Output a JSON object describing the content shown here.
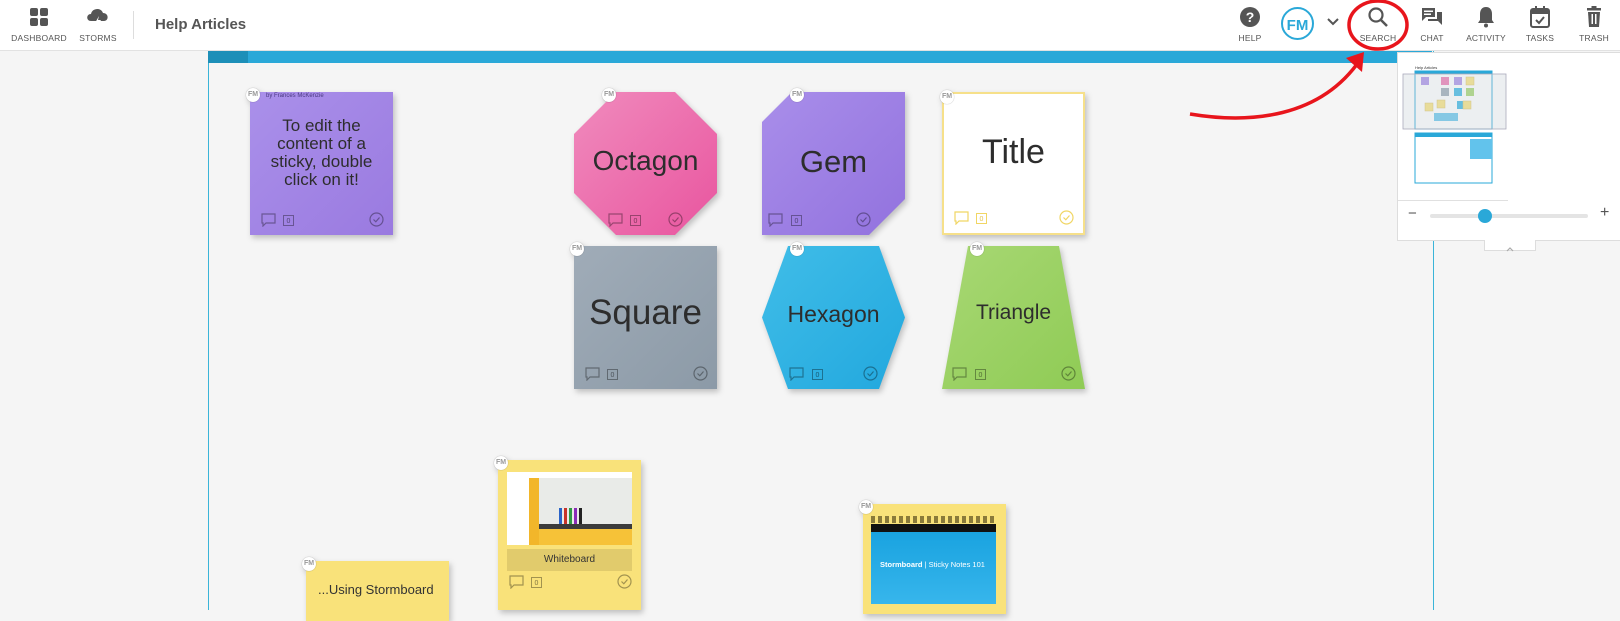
{
  "topbar": {
    "dashboard_label": "DASHBOARD",
    "storms_label": "STORMS",
    "page_title": "Help Articles",
    "help_label": "HELP",
    "avatar_initials": "FM",
    "search_label": "SEARCH",
    "chat_label": "CHAT",
    "activity_label": "ACTIVITY",
    "tasks_label": "TASKS",
    "trash_label": "TRASH"
  },
  "stickies": {
    "intro": {
      "author": "by Frances McKenzie",
      "text": "To edit the content of a sticky, double click on it!",
      "count": "0",
      "color": "#a88ce8"
    },
    "octagon": {
      "text": "Octagon",
      "count": "0",
      "color": "#ee74b0"
    },
    "gem": {
      "text": "Gem",
      "count": "0",
      "color": "#a88ce8"
    },
    "title": {
      "text": "Title",
      "count": "0",
      "color": "#ffffff"
    },
    "square": {
      "text": "Square",
      "count": "0",
      "color": "#98a6b2"
    },
    "hexagon": {
      "text": "Hexagon",
      "count": "0",
      "color": "#33b4e4"
    },
    "triangle": {
      "text": "Triangle",
      "count": "0",
      "color": "#a1d56a"
    },
    "whiteboard": {
      "caption": "Whiteboard",
      "count": "0",
      "color": "#f9e27a"
    },
    "bottom_left": {
      "text": "...Using Stormboard",
      "color": "#f9e27a"
    },
    "video": {
      "brand": "Stormboard",
      "subtitle": "| Sticky Notes 101",
      "color": "#f9e27a"
    }
  },
  "minimap": {
    "title": "Help Articles",
    "zoom_minus": "−",
    "zoom_plus": "+",
    "zoom_level": 0.33
  },
  "annotation": {
    "color": "#e8151c"
  },
  "colors": {
    "accent": "#2aa8d8",
    "sticky_yellow": "#f9e27a"
  }
}
